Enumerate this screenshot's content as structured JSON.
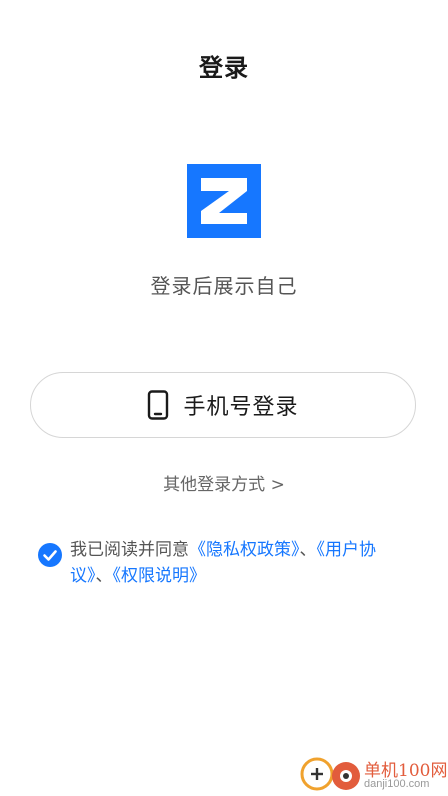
{
  "header": {
    "title": "登录"
  },
  "brand": {
    "logo_icon": "z-logo-icon",
    "accent": "#1677ff",
    "tagline": "登录后展示自己"
  },
  "login": {
    "phone_button_label": "手机号登录",
    "phone_icon": "phone-icon",
    "other_methods_label": "其他登录方式 >"
  },
  "agreement": {
    "checked": true,
    "prefix": "我已阅读并同意",
    "privacy_link": "《隐私权政策》",
    "sep1": "、",
    "user_link": "《用户协议》",
    "sep2": "、",
    "permission_link": "《权限说明》"
  },
  "watermark": {
    "name": "单机100网",
    "url": "danji100.com"
  }
}
